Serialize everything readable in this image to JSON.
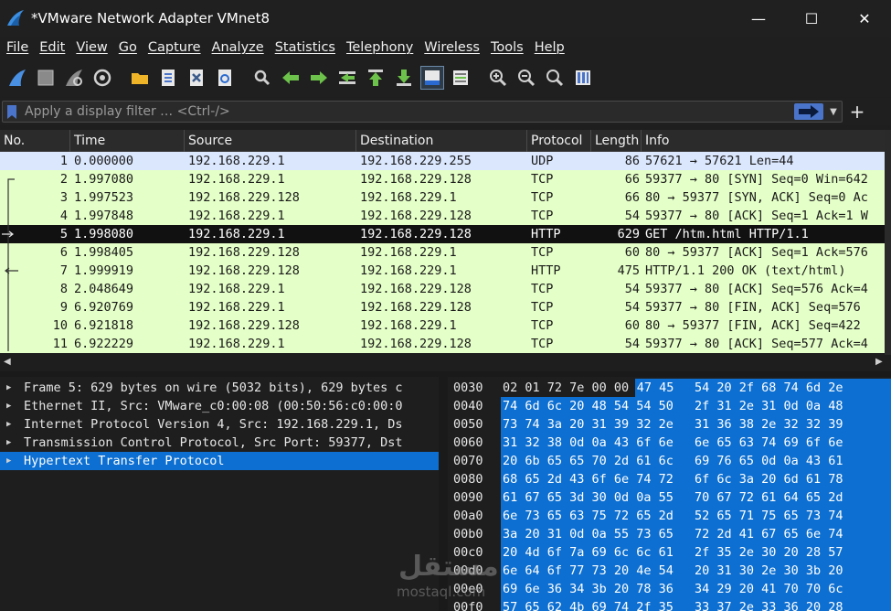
{
  "window": {
    "title": "*VMware Network Adapter VMnet8",
    "min_glyph": "—",
    "max_glyph": "☐",
    "close_glyph": "✕"
  },
  "menu": [
    "File",
    "Edit",
    "View",
    "Go",
    "Capture",
    "Analyze",
    "Statistics",
    "Telephony",
    "Wireless",
    "Tools",
    "Help"
  ],
  "toolbar_icons": [
    "shark-fin-start-icon",
    "stop-capture-icon",
    "restart-capture-icon",
    "capture-options-icon",
    "open-file-icon",
    "save-file-icon",
    "close-file-icon",
    "reload-file-icon",
    "find-packet-icon",
    "go-back-icon",
    "go-forward-icon",
    "go-to-packet-icon",
    "go-first-icon",
    "go-last-icon",
    "autoscroll-icon",
    "colorize-icon",
    "zoom-in-icon",
    "zoom-out-icon",
    "zoom-normal-icon",
    "resize-columns-icon"
  ],
  "filter": {
    "placeholder": "Apply a display filter … <Ctrl-/>",
    "plus": "+"
  },
  "columns": [
    "No.",
    "Time",
    "Source",
    "Destination",
    "Protocol",
    "Length",
    "Info"
  ],
  "packets": [
    {
      "no": "1",
      "time": "0.000000",
      "src": "192.168.229.1",
      "dst": "192.168.229.255",
      "proto": "UDP",
      "len": "86",
      "info": "57621 → 57621 Len=44",
      "kind": "udp"
    },
    {
      "no": "2",
      "time": "1.997080",
      "src": "192.168.229.1",
      "dst": "192.168.229.128",
      "proto": "TCP",
      "len": "66",
      "info": "59377 → 80 [SYN] Seq=0 Win=642",
      "kind": "tcp"
    },
    {
      "no": "3",
      "time": "1.997523",
      "src": "192.168.229.128",
      "dst": "192.168.229.1",
      "proto": "TCP",
      "len": "66",
      "info": "80 → 59377 [SYN, ACK] Seq=0 Ac",
      "kind": "tcp"
    },
    {
      "no": "4",
      "time": "1.997848",
      "src": "192.168.229.1",
      "dst": "192.168.229.128",
      "proto": "TCP",
      "len": "54",
      "info": "59377 → 80 [ACK] Seq=1 Ack=1 W",
      "kind": "tcp"
    },
    {
      "no": "5",
      "time": "1.998080",
      "src": "192.168.229.1",
      "dst": "192.168.229.128",
      "proto": "HTTP",
      "len": "629",
      "info": "GET /htm.html HTTP/1.1",
      "kind": "sel"
    },
    {
      "no": "6",
      "time": "1.998405",
      "src": "192.168.229.128",
      "dst": "192.168.229.1",
      "proto": "TCP",
      "len": "60",
      "info": "80 → 59377 [ACK] Seq=1 Ack=576",
      "kind": "tcp"
    },
    {
      "no": "7",
      "time": "1.999919",
      "src": "192.168.229.128",
      "dst": "192.168.229.1",
      "proto": "HTTP",
      "len": "475",
      "info": "HTTP/1.1 200 OK  (text/html)",
      "kind": "tcp"
    },
    {
      "no": "8",
      "time": "2.048649",
      "src": "192.168.229.1",
      "dst": "192.168.229.128",
      "proto": "TCP",
      "len": "54",
      "info": "59377 → 80 [ACK] Seq=576 Ack=4",
      "kind": "tcp"
    },
    {
      "no": "9",
      "time": "6.920769",
      "src": "192.168.229.1",
      "dst": "192.168.229.128",
      "proto": "TCP",
      "len": "54",
      "info": "59377 → 80 [FIN, ACK] Seq=576",
      "kind": "tcp"
    },
    {
      "no": "10",
      "time": "6.921818",
      "src": "192.168.229.128",
      "dst": "192.168.229.1",
      "proto": "TCP",
      "len": "60",
      "info": "80 → 59377 [FIN, ACK] Seq=422",
      "kind": "tcp"
    },
    {
      "no": "11",
      "time": "6.922229",
      "src": "192.168.229.1",
      "dst": "192.168.229.128",
      "proto": "TCP",
      "len": "54",
      "info": "59377 → 80 [ACK] Seq=577 Ack=4",
      "kind": "tcp"
    }
  ],
  "details": [
    {
      "text": "Frame 5: 629 bytes on wire (5032 bits), 629 bytes c",
      "selected": false
    },
    {
      "text": "Ethernet II, Src: VMware_c0:00:08 (00:50:56:c0:00:0",
      "selected": false
    },
    {
      "text": "Internet Protocol Version 4, Src: 192.168.229.1, Ds",
      "selected": false
    },
    {
      "text": "Transmission Control Protocol, Src Port: 59377, Dst",
      "selected": false
    },
    {
      "text": "Hypertext Transfer Protocol",
      "selected": true
    }
  ],
  "bytes": [
    {
      "off": "0030",
      "h1": "02 01 72 7e 00 00",
      "h1b": "47 45",
      "h2": "54 20 2f 68 74 6d 2e"
    },
    {
      "off": "0040",
      "h1": "74 6d 6c 20 48 54 54 50",
      "h2": "2f 31 2e 31 0d 0a 48"
    },
    {
      "off": "0050",
      "h1": "73 74 3a 20 31 39 32 2e",
      "h2": "31 36 38 2e 32 32 39"
    },
    {
      "off": "0060",
      "h1": "31 32 38 0d 0a 43 6f 6e",
      "h2": "6e 65 63 74 69 6f 6e"
    },
    {
      "off": "0070",
      "h1": "20 6b 65 65 70 2d 61 6c",
      "h2": "69 76 65 0d 0a 43 61"
    },
    {
      "off": "0080",
      "h1": "68 65 2d 43 6f 6e 74 72",
      "h2": "6f 6c 3a 20 6d 61 78"
    },
    {
      "off": "0090",
      "h1": "61 67 65 3d 30 0d 0a 55",
      "h2": "70 67 72 61 64 65 2d"
    },
    {
      "off": "00a0",
      "h1": "6e 73 65 63 75 72 65 2d",
      "h2": "52 65 71 75 65 73 74"
    },
    {
      "off": "00b0",
      "h1": "3a 20 31 0d 0a 55 73 65",
      "h2": "72 2d 41 67 65 6e 74"
    },
    {
      "off": "00c0",
      "h1": "20 4d 6f 7a 69 6c 6c 61",
      "h2": "2f 35 2e 30 20 28 57"
    },
    {
      "off": "00d0",
      "h1": "6e 64 6f 77 73 20 4e 54",
      "h2": "20 31 30 2e 30 3b 20"
    },
    {
      "off": "00e0",
      "h1": "69 6e 36 34 3b 20 78 36",
      "h2": "34 29 20 41 70 70 6c"
    },
    {
      "off": "00f0",
      "h1": "57 65 62 4b 69 74 2f 35",
      "h2": "33 37 2e 33 36 20 28"
    }
  ],
  "watermark": {
    "ar": "مستقل",
    "en": "mostaql.com"
  },
  "colors": {
    "udp_row": "#dbe7fd",
    "tcp_row": "#e4ffc7",
    "selected_row": "#111111",
    "highlight": "#0d6fd1"
  }
}
